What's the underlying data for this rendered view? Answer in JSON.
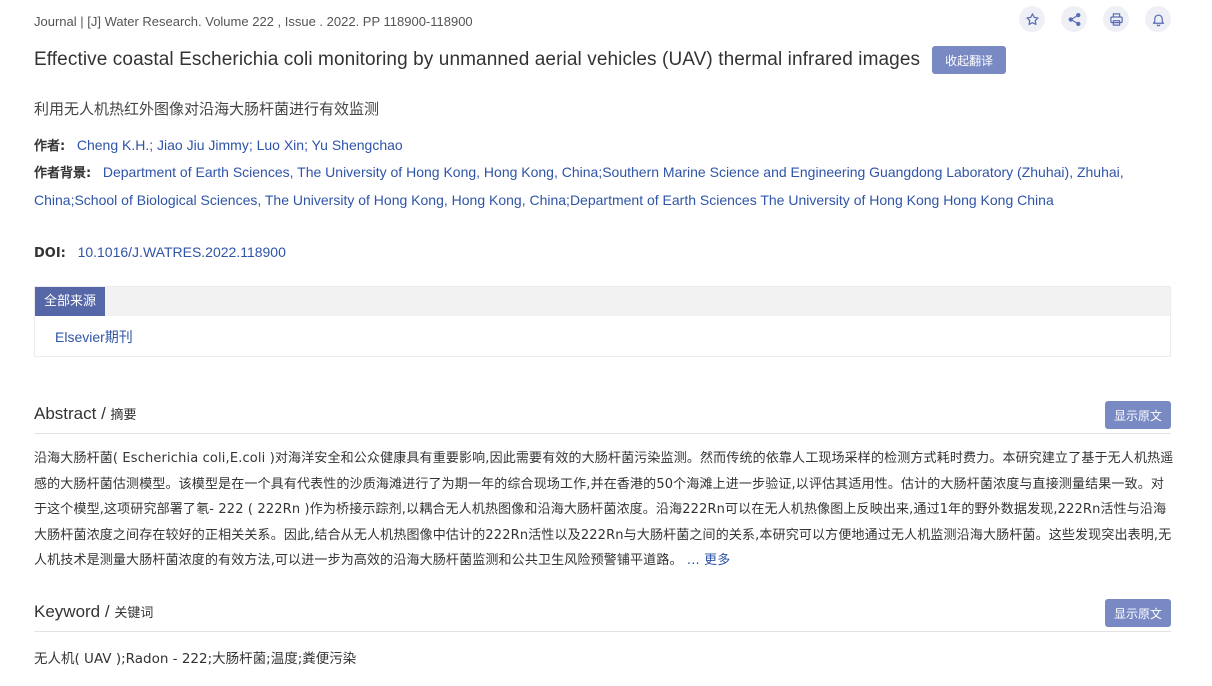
{
  "journal": {
    "prefix": "Journal | [J] ",
    "name": "Water Research",
    "suffix": ". Volume 222 , Issue . 2022. PP 118900-118900"
  },
  "actions": {
    "favorite_icon": "star-icon",
    "share_icon": "share-icon",
    "print_icon": "printer-icon",
    "alert_icon": "bell-icon"
  },
  "title": "Effective coastal Escherichia coli monitoring by unmanned aerial vehicles (UAV) thermal infrared images",
  "collapse_translation_label": "收起翻译",
  "translated_title": "利用无人机热红外图像对沿海大肠杆菌进行有效监测",
  "authors": {
    "label": "作者:",
    "value": "Cheng K.H.; Jiao Jiu Jimmy; Luo Xin; Yu Shengchao"
  },
  "affiliation": {
    "label": "作者背景:",
    "value": "Department of Earth Sciences, The University of Hong Kong, Hong Kong, China;Southern Marine Science and Engineering Guangdong Laboratory (Zhuhai), Zhuhai, China;School of Biological Sciences, The University of Hong Kong, Hong Kong, China;Department of Earth Sciences The University of Hong Kong Hong Kong China"
  },
  "doi": {
    "label": "DOI:",
    "value": "10.1016/J.WATRES.2022.118900"
  },
  "sources": {
    "tab_label": "全部来源",
    "items": [
      "Elsevier期刊"
    ]
  },
  "abstract": {
    "title": "Abstract / ",
    "subtitle": "摘要",
    "show_original_label": "显示原文",
    "text": "沿海大肠杆菌( Escherichia coli,E.coli )对海洋安全和公众健康具有重要影响,因此需要有效的大肠杆菌污染监测。然而传统的依靠人工现场采样的检测方式耗时费力。本研究建立了基于无人机热遥感的大肠杆菌估测模型。该模型是在一个具有代表性的沙质海滩进行了为期一年的综合现场工作,并在香港的50个海滩上进一步验证,以评估其适用性。估计的大肠杆菌浓度与直接测量结果一致。对于这个模型,这项研究部署了氡- 222 ( 222Rn )作为桥接示踪剂,以耦合无人机热图像和沿海大肠杆菌浓度。沿海222Rn可以在无人机热像图上反映出来,通过1年的野外数据发现,222Rn活性与沿海大肠杆菌浓度之间存在较好的正相关关系。因此,结合从无人机热图像中估计的222Rn活性以及222Rn与大肠杆菌之间的关系,本研究可以方便地通过无人机监测沿海大肠杆菌。这些发现突出表明,无人机技术是测量大肠杆菌浓度的有效方法,可以进一步为高效的沿海大肠杆菌监测和公共卫生风险预警铺平道路。 ",
    "more_label": "... 更多"
  },
  "keyword": {
    "title": "Keyword / ",
    "subtitle": "关键词",
    "show_original_label": "显示原文",
    "text": "无人机( UAV );Radon - 222;大肠杆菌;温度;粪便污染"
  }
}
